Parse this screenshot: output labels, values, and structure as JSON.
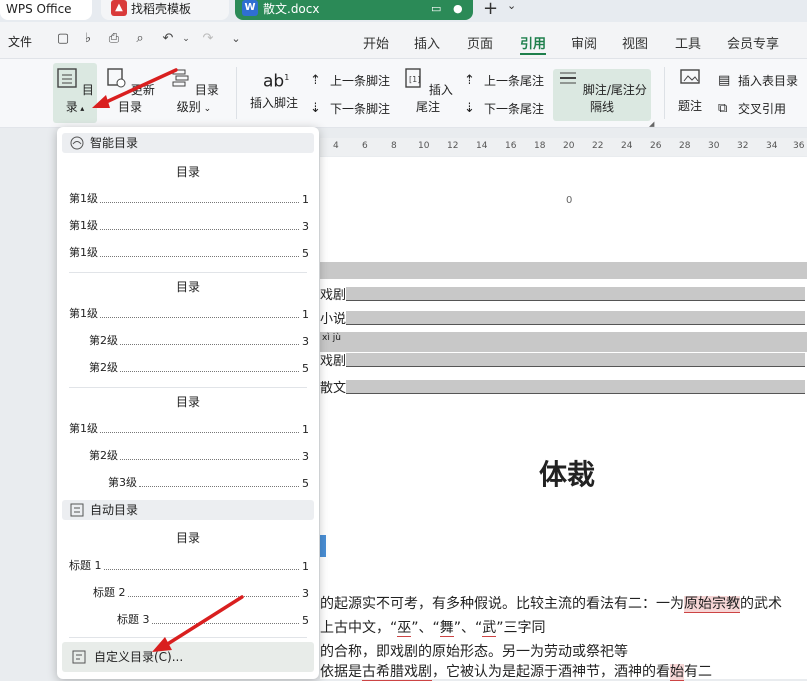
{
  "tabs": {
    "wps": "WPS Office",
    "templates": "找稻壳模板",
    "doc": "散文.docx"
  },
  "menubar": {
    "file": "文件",
    "items": [
      "开始",
      "插入",
      "页面",
      "引用",
      "审阅",
      "视图",
      "工具",
      "会员专享"
    ],
    "active": "引用"
  },
  "ribbon": {
    "toc": "目录",
    "update_toc": "更新目录",
    "toc_level": "目录级别",
    "insert_footnote": "插入脚注",
    "prev_footnote": "上一条脚注",
    "next_footnote": "下一条脚注",
    "insert_endnote": "插入尾注",
    "prev_endnote": "上一条尾注",
    "next_endnote": "下一条尾注",
    "separator": "脚注/尾注分隔线",
    "caption": "题注",
    "insert_table_of_figures": "插入表目录",
    "cross_reference": "交叉引用"
  },
  "dropdown": {
    "smart_toc": "智能目录",
    "auto_toc": "自动目录",
    "custom_toc": "自定义目录(C)...",
    "toc_heading": "目录",
    "style1": [
      {
        "label": "第1级",
        "page": "1"
      },
      {
        "label": "第1级",
        "page": "3"
      },
      {
        "label": "第1级",
        "page": "5"
      }
    ],
    "style2": [
      {
        "label": "第1级",
        "page": "1"
      },
      {
        "label": "第2级",
        "page": "3"
      },
      {
        "label": "第2级",
        "page": "5"
      }
    ],
    "style3": [
      {
        "label": "第1级",
        "page": "1"
      },
      {
        "label": "第2级",
        "page": "3"
      },
      {
        "label": "第3级",
        "page": "5"
      }
    ],
    "auto": [
      {
        "label": "标题 1",
        "page": "1"
      },
      {
        "label": "标题 2",
        "page": "3"
      },
      {
        "label": "标题 3",
        "page": "5"
      }
    ]
  },
  "ruler": {
    "ticks": [
      "4",
      "6",
      "8",
      "10",
      "12",
      "14",
      "16",
      "18",
      "20",
      "22",
      "24",
      "26",
      "28",
      "30",
      "32",
      "34",
      "36"
    ],
    "zero": "0"
  },
  "document": {
    "toc_lines": [
      "戏剧",
      "小说",
      "戏剧",
      "散文"
    ],
    "pinyin": "xì jù",
    "title": "体裁",
    "para1_a": "的起源实不可考，有多种假说。比较主流的看法有二：一为",
    "para1_mark": "原始宗教",
    "para1_b": "的武术",
    "para2_a": "上古中文，“",
    "para2_w1": "巫",
    "para2_sep1": "”、“",
    "para2_w2": "舞",
    "para2_sep2": "”、“",
    "para2_w3": "武",
    "para2_b": "”三字同",
    "para3": "的合称，即戏剧的原始形态。另一为劳动或祭祀等",
    "para4_a": "依据是",
    "para4_mark": "古希腊戏剧",
    "para4_b": "，它被认为是起源于酒神节，酒神的看",
    "para4_mark2": "始",
    "para4_c": "有二"
  }
}
